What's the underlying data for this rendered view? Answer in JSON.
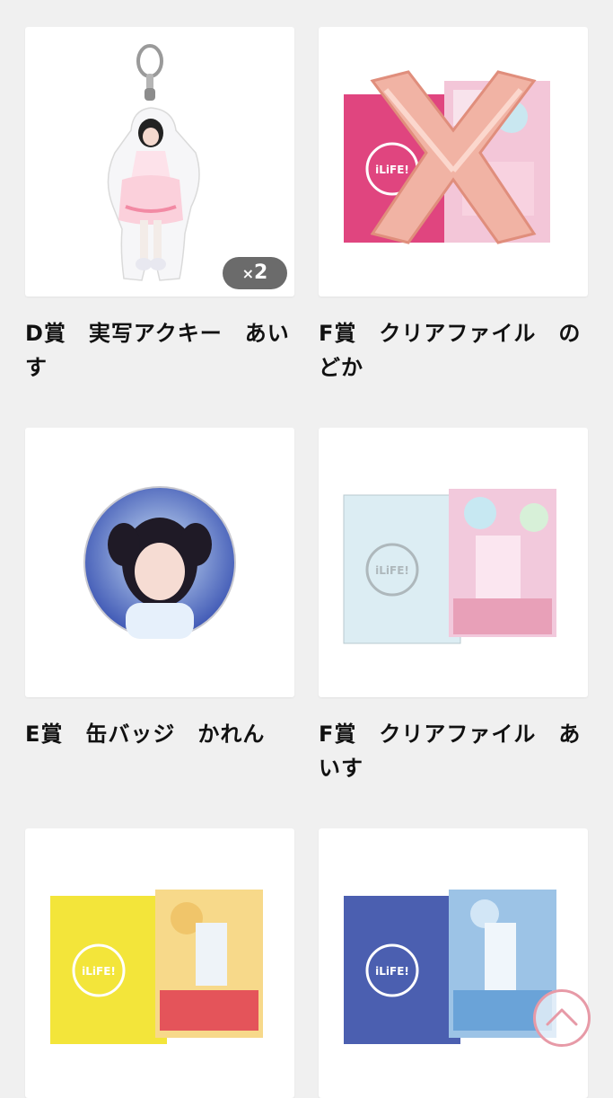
{
  "products": [
    {
      "title": "D賞　実写アクキー　あいす",
      "badge_prefix": "×",
      "badge_count": "2",
      "image_icon": "acrylic-keychain-photo"
    },
    {
      "title": "F賞　クリアファイル　のどか",
      "image_icon": "clear-file-pink-with-x-balloon"
    },
    {
      "title": "E賞　缶バッジ　かれん",
      "image_icon": "can-badge-photo"
    },
    {
      "title": "F賞　クリアファイル　あいす",
      "image_icon": "clear-file-light-blue"
    },
    {
      "image_icon": "clear-file-yellow"
    },
    {
      "image_icon": "clear-file-blue"
    }
  ],
  "logo_text": "iLiFE!",
  "scroll_top": {
    "icon": "chevron-up-icon"
  },
  "colors": {
    "accent": "#e79aa7",
    "pink_file": "#e0457f",
    "yellow_file": "#f3e53a",
    "blue_file": "#4b5fb0",
    "lightblue_file": "#dcedf3"
  }
}
